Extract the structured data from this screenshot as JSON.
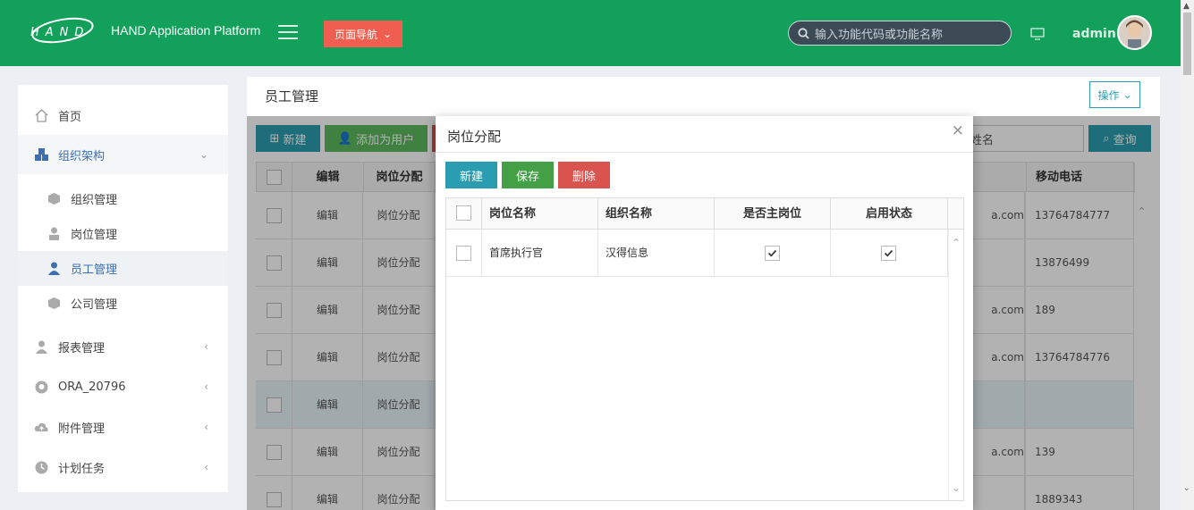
{
  "header": {
    "logo_text": "HAND",
    "app_title": "HAND Application Platform",
    "nav_button": "页面导航",
    "search_placeholder": "输入功能代码或功能名称",
    "username": "admin"
  },
  "sidebar": {
    "items": [
      {
        "label": "首页",
        "icon": "home-icon"
      },
      {
        "label": "组织架构",
        "icon": "cubes-icon"
      },
      {
        "label": "报表管理",
        "icon": "user-icon"
      },
      {
        "label": "ORA_20796",
        "icon": "github-icon"
      },
      {
        "label": "附件管理",
        "icon": "cloud-upload-icon"
      },
      {
        "label": "计划任务",
        "icon": "clock-icon"
      }
    ],
    "subitems": [
      {
        "label": "组织管理",
        "icon": "cube-icon"
      },
      {
        "label": "岗位管理",
        "icon": "user-tie-icon"
      },
      {
        "label": "员工管理",
        "icon": "user-icon"
      },
      {
        "label": "公司管理",
        "icon": "cube-icon"
      }
    ]
  },
  "content": {
    "title": "员工管理",
    "ops_button": "操作",
    "toolbar": {
      "new": "新建",
      "add_user": "添加为用户",
      "search_placeholder": "姓名",
      "query": "查询"
    },
    "columns": [
      "编辑",
      "岗位分配",
      "移动电话"
    ],
    "rows": [
      {
        "edit": "编辑",
        "assign": "岗位分配",
        "email_tail": "a.com",
        "phone": "13764784777"
      },
      {
        "edit": "编辑",
        "assign": "岗位分配",
        "email_tail": "",
        "phone": "13876499"
      },
      {
        "edit": "编辑",
        "assign": "岗位分配",
        "email_tail": "a.com",
        "phone": "189"
      },
      {
        "edit": "编辑",
        "assign": "岗位分配",
        "email_tail": "a.com",
        "phone": "13764784776"
      },
      {
        "edit": "编辑",
        "assign": "岗位分配",
        "email_tail": "",
        "phone": ""
      },
      {
        "edit": "编辑",
        "assign": "岗位分配",
        "email_tail": "a.com",
        "phone": "139"
      },
      {
        "edit": "编辑",
        "assign": "岗位分配",
        "email_tail": "",
        "phone": "1889343"
      }
    ]
  },
  "modal": {
    "title": "岗位分配",
    "buttons": {
      "new": "新建",
      "save": "保存",
      "delete": "删除"
    },
    "columns": [
      "岗位名称",
      "组织名称",
      "是否主岗位",
      "启用状态"
    ],
    "rows": [
      {
        "position": "首席执行官",
        "org": "汉得信息",
        "primary": true,
        "enabled": true
      }
    ]
  }
}
